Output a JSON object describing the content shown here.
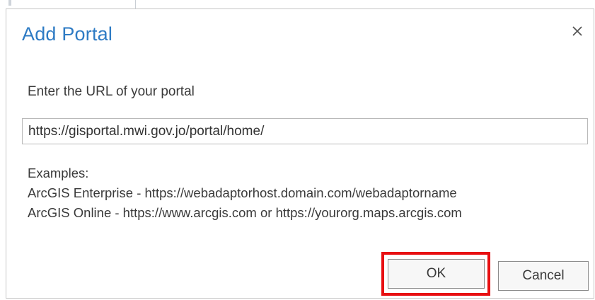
{
  "dialog": {
    "title": "Add Portal",
    "close_icon": "close-icon",
    "prompt": "Enter the URL of your portal",
    "url_value": "https://gisportal.mwi.gov.jo/portal/home/",
    "examples_heading": "Examples:",
    "examples": [
      "ArcGIS Enterprise - https://webadaptorhost.domain.com/webadaptorname",
      "ArcGIS Online - https://www.arcgis.com or https://yourorg.maps.arcgis.com"
    ],
    "buttons": {
      "ok_label": "OK",
      "cancel_label": "Cancel"
    }
  },
  "colors": {
    "title": "#2e7bc4",
    "highlight": "#e80f12",
    "text": "#3a3a3a"
  }
}
